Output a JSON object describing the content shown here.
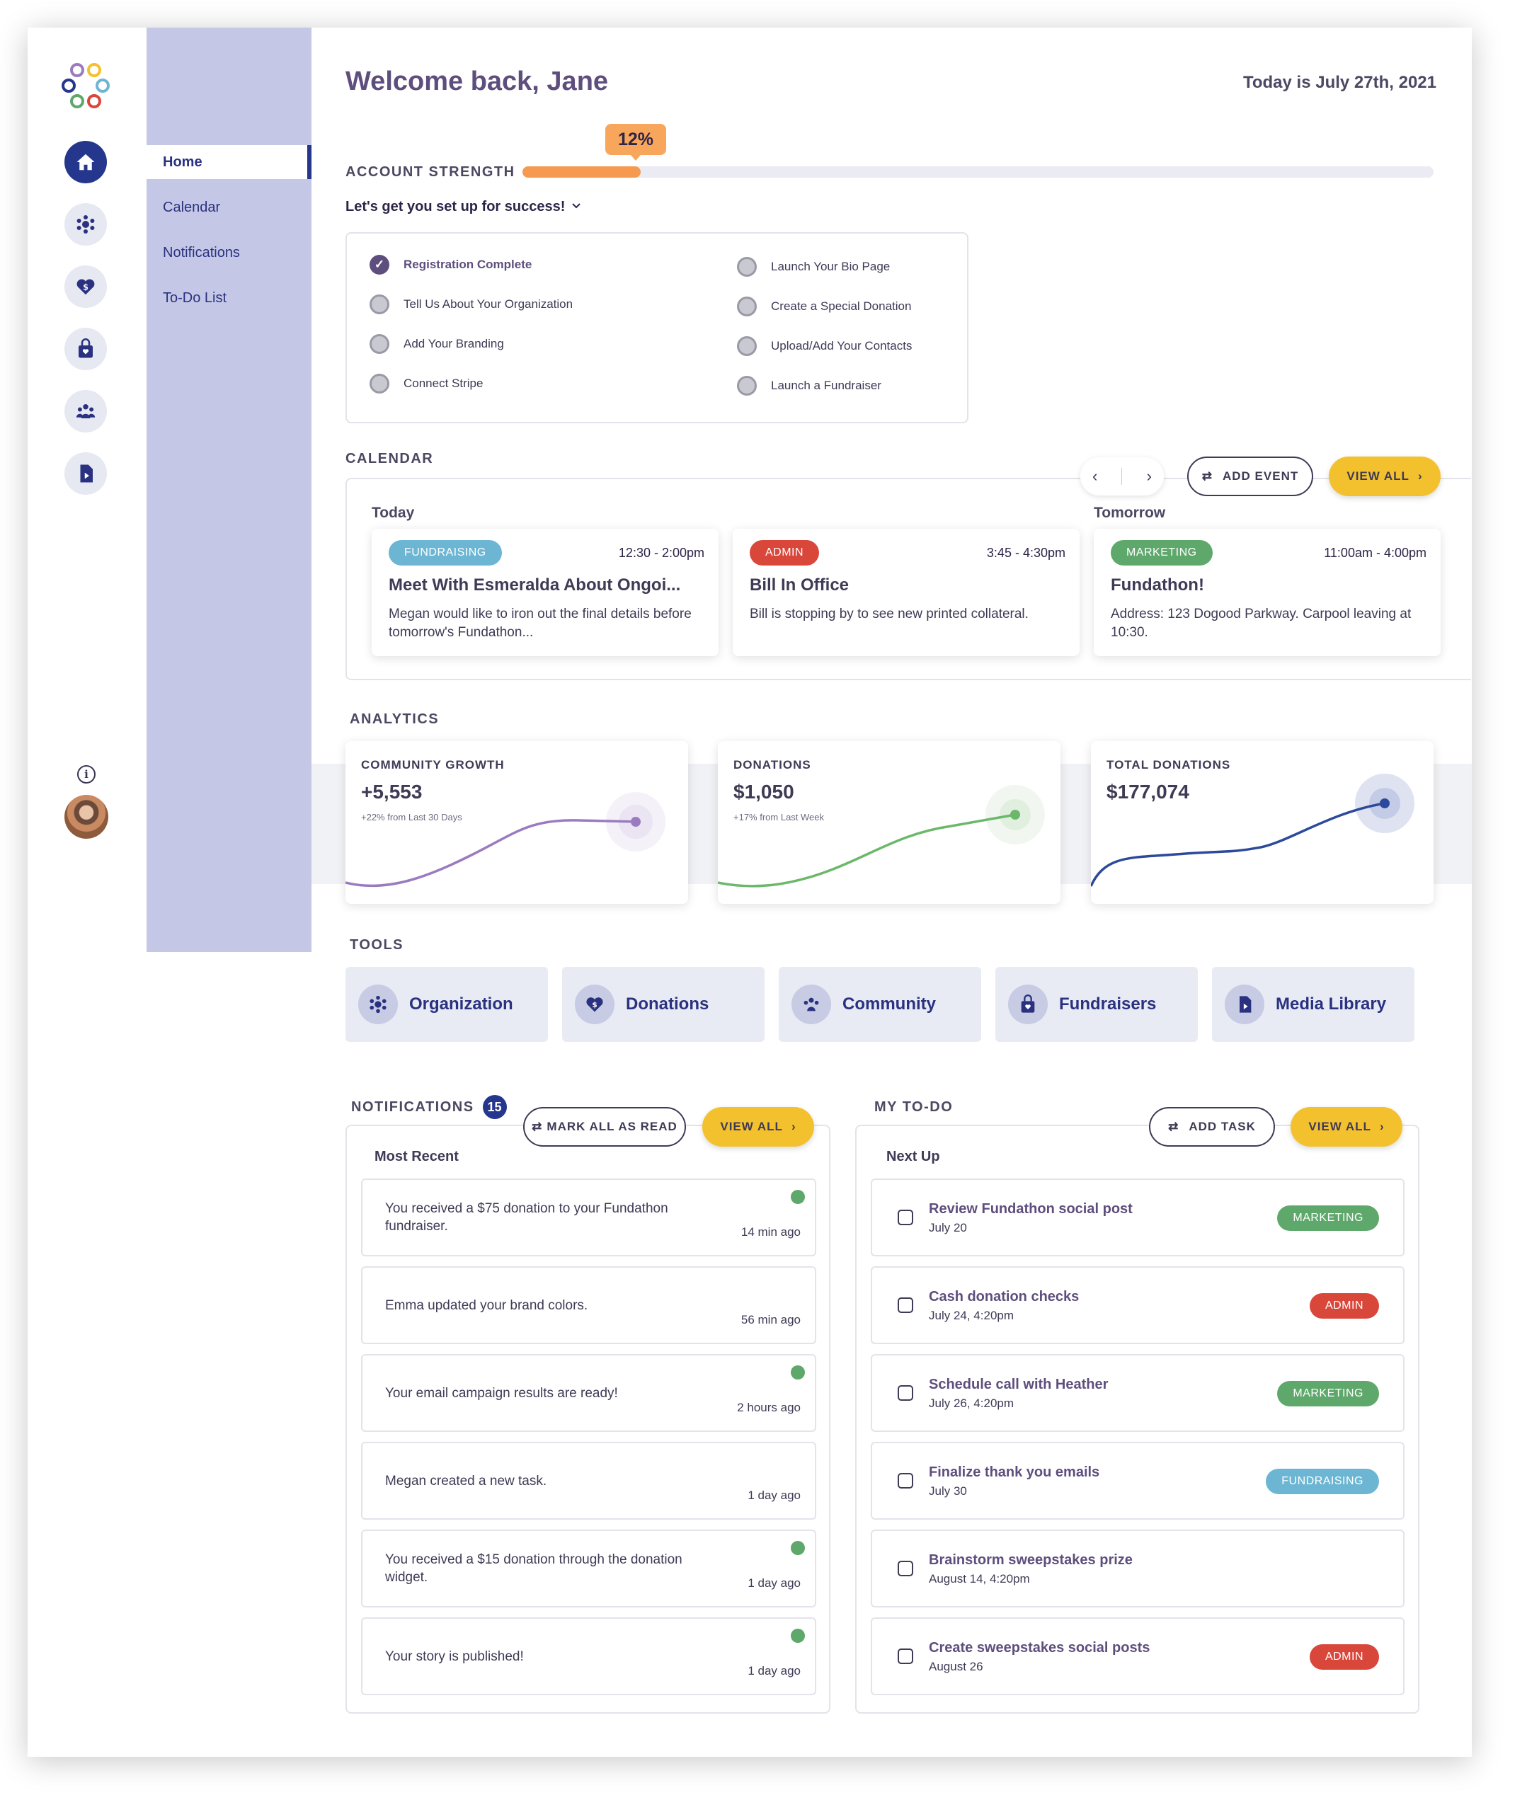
{
  "sidebar": {
    "nav": [
      "home-icon",
      "organization-icon",
      "donations-icon",
      "fundraisers-icon",
      "community-icon",
      "media-library-icon"
    ],
    "subnav": [
      "Home",
      "Calendar",
      "Notifications",
      "To-Do List"
    ]
  },
  "header": {
    "welcome": "Welcome back, Jane",
    "date": "Today is July 27th, 2021"
  },
  "account": {
    "title": "ACCOUNT STRENGTH",
    "percent_label": "12%",
    "percent": 0.13,
    "setup": "Let's get you set up for success!",
    "checklist_left": [
      {
        "label": "Registration Complete",
        "done": true
      },
      {
        "label": "Tell Us About Your Organization",
        "done": false
      },
      {
        "label": "Add Your Branding",
        "done": false
      },
      {
        "label": "Connect Stripe",
        "done": false
      }
    ],
    "checklist_right": [
      {
        "label": "Launch Your Bio Page",
        "done": false
      },
      {
        "label": "Create a Special Donation",
        "done": false
      },
      {
        "label": "Upload/Add Your Contacts",
        "done": false
      },
      {
        "label": "Launch a Fundraiser",
        "done": false
      }
    ]
  },
  "calendar": {
    "title": "CALENDAR",
    "add_event": "ADD EVENT",
    "view_all": "VIEW ALL",
    "today": "Today",
    "tomorrow": "Tomorrow",
    "events": [
      {
        "tag": "FUNDRAISING",
        "time": "12:30 - 2:00pm",
        "title": "Meet With Esmeralda About Ongoi...",
        "body": "Megan would like to iron out the final details before tomorrow's Fundathon..."
      },
      {
        "tag": "ADMIN",
        "time": "3:45 - 4:30pm",
        "title": "Bill In Office",
        "body": "Bill is stopping by to see new printed collateral."
      },
      {
        "tag": "MARKETING",
        "time": "11:00am - 4:00pm",
        "title": "Fundathon!",
        "body": "Address: 123 Dogood Parkway. Carpool leaving at 10:30."
      }
    ]
  },
  "analytics": {
    "title": "ANALYTICS",
    "cards": [
      {
        "label": "COMMUNITY GROWTH",
        "value": "+5,553",
        "sub": "+22% from Last 30 Days",
        "color": "#9b7bc0"
      },
      {
        "label": "DONATIONS",
        "value": "$1,050",
        "sub": "+17% from Last Week",
        "color": "#6cb86a"
      },
      {
        "label": "TOTAL DONATIONS",
        "value": "$177,074",
        "sub": "",
        "color": "#2c4a9c"
      }
    ]
  },
  "tools": {
    "title": "TOOLS",
    "items": [
      "Organization",
      "Donations",
      "Community",
      "Fundraisers",
      "Media Library"
    ]
  },
  "notifications": {
    "title": "NOTIFICATIONS",
    "count": "15",
    "mark_all": "MARK ALL AS READ",
    "view_all": "VIEW ALL",
    "subtitle": "Most Recent",
    "items": [
      {
        "text": "You received a $75 donation to your Fundathon fundraiser.",
        "ago": "14 min ago",
        "unread": true
      },
      {
        "text": "Emma updated your brand colors.",
        "ago": "56 min ago",
        "unread": false
      },
      {
        "text": "Your email campaign results are ready!",
        "ago": "2 hours ago",
        "unread": true
      },
      {
        "text": "Megan created a new task.",
        "ago": "1 day ago",
        "unread": false
      },
      {
        "text": "You received a $15 donation through the donation widget.",
        "ago": "1 day ago",
        "unread": true
      },
      {
        "text": "Your story is published!",
        "ago": "1 day ago",
        "unread": true
      }
    ]
  },
  "todo": {
    "title": "MY TO-DO",
    "add_task": "ADD TASK",
    "view_all": "VIEW ALL",
    "subtitle": "Next Up",
    "items": [
      {
        "title": "Review Fundathon social post",
        "date": "July 20",
        "tag": "MARKETING"
      },
      {
        "title": "Cash donation checks",
        "date": "July 24, 4:20pm",
        "tag": "ADMIN"
      },
      {
        "title": "Schedule call with Heather",
        "date": "July 26, 4:20pm",
        "tag": "MARKETING"
      },
      {
        "title": "Finalize thank you emails",
        "date": "July 30",
        "tag": "FUNDRAISING"
      },
      {
        "title": "Brainstorm sweepstakes prize",
        "date": "August 14, 4:20pm",
        "tag": ""
      },
      {
        "title": "Create sweepstakes social posts",
        "date": "August 26",
        "tag": "ADMIN"
      }
    ]
  },
  "colors": {
    "brand": "#25378d",
    "accent": "#f4c12e",
    "progress": "#f59a4f"
  }
}
